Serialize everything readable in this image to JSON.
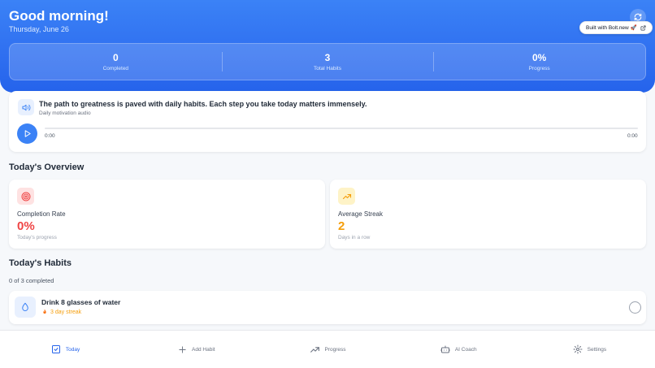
{
  "header": {
    "greeting": "Good morning!",
    "date": "Thursday, June 26",
    "bolt_badge": "Built with Bolt.new 🚀",
    "refresh_icon": "refresh-icon",
    "external_link_icon": "external-link-icon"
  },
  "stats": [
    {
      "value": "0",
      "label": "Completed"
    },
    {
      "value": "3",
      "label": "Total Habits"
    },
    {
      "value": "0%",
      "label": "Progress"
    }
  ],
  "audio": {
    "quote": "The path to greatness is paved with daily habits. Each step you take today matters immensely.",
    "subtitle": "Daily motivation audio",
    "time_current": "0:00",
    "time_total": "0:00",
    "progress": 0,
    "speaker_icon": "speaker-icon",
    "play_icon": "play-icon"
  },
  "overview": {
    "title": "Today's Overview",
    "cards": [
      {
        "label": "Completion Rate",
        "value": "0%",
        "sub": "Today's progress",
        "icon": "target-icon",
        "color": "#ef4444",
        "bg": "#fee2e2"
      },
      {
        "label": "Average Streak",
        "value": "2",
        "sub": "Days in a row",
        "icon": "trending-up-icon",
        "color": "#f59e0b",
        "bg": "#fef3c7"
      }
    ]
  },
  "habits": {
    "title": "Today's Habits",
    "count_text": "0 of 3 completed",
    "items": [
      {
        "name": "Drink 8 glasses of water",
        "streak": "3 day streak",
        "icon": "water-drop-icon",
        "done": false
      }
    ]
  },
  "nav": [
    {
      "label": "Today",
      "icon": "check-square-icon",
      "active": true
    },
    {
      "label": "Add Habit",
      "icon": "plus-icon",
      "active": false
    },
    {
      "label": "Progress",
      "icon": "trending-up-icon",
      "active": false
    },
    {
      "label": "AI Coach",
      "icon": "bot-icon",
      "active": false
    },
    {
      "label": "Settings",
      "icon": "gear-icon",
      "active": false
    }
  ],
  "colors": {
    "accent": "#3b82f6",
    "header_gradient": [
      "#3b82f6",
      "#2563eb"
    ],
    "streak": "#f59e0b",
    "danger": "#ef4444"
  }
}
